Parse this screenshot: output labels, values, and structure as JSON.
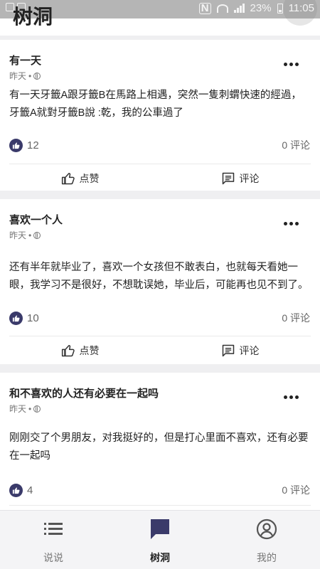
{
  "status_bar": {
    "battery": "23%",
    "time": "11:05"
  },
  "header": {
    "title": "树洞"
  },
  "posts": [
    {
      "title": "有一天",
      "time": "昨天",
      "body": "有一天牙籤A跟牙籤B在馬路上相遇，突然一隻刺蝟快速的經過，牙籤A就對牙籤B說 :乾，我的公車過了",
      "likes": "12",
      "comments": "0 评论",
      "like_label": "点赞",
      "comment_label": "评论"
    },
    {
      "title": "喜欢一个人",
      "time": "昨天",
      "body": "还有半年就毕业了，喜欢一个女孩但不敢表白，也就每天看她一眼，我学习不是很好，不想耽误她，毕业后，可能再也见不到了。",
      "likes": "10",
      "comments": "0 评论",
      "like_label": "点赞",
      "comment_label": "评论"
    },
    {
      "title": "和不喜欢的人还有必要在一起吗",
      "time": "昨天",
      "body": "刚刚交了个男朋友，对我挺好的，但是打心里面不喜欢，还有必要在一起吗",
      "likes": "4",
      "comments": "0 评论"
    }
  ],
  "bottom_nav": [
    {
      "label": "说说",
      "icon": "list-icon",
      "active": false
    },
    {
      "label": "树洞",
      "icon": "chat-bubble-icon",
      "active": true
    },
    {
      "label": "我的",
      "icon": "profile-icon",
      "active": false
    }
  ],
  "colors": {
    "accent": "#3a3a6a",
    "background": "#efeff1"
  }
}
